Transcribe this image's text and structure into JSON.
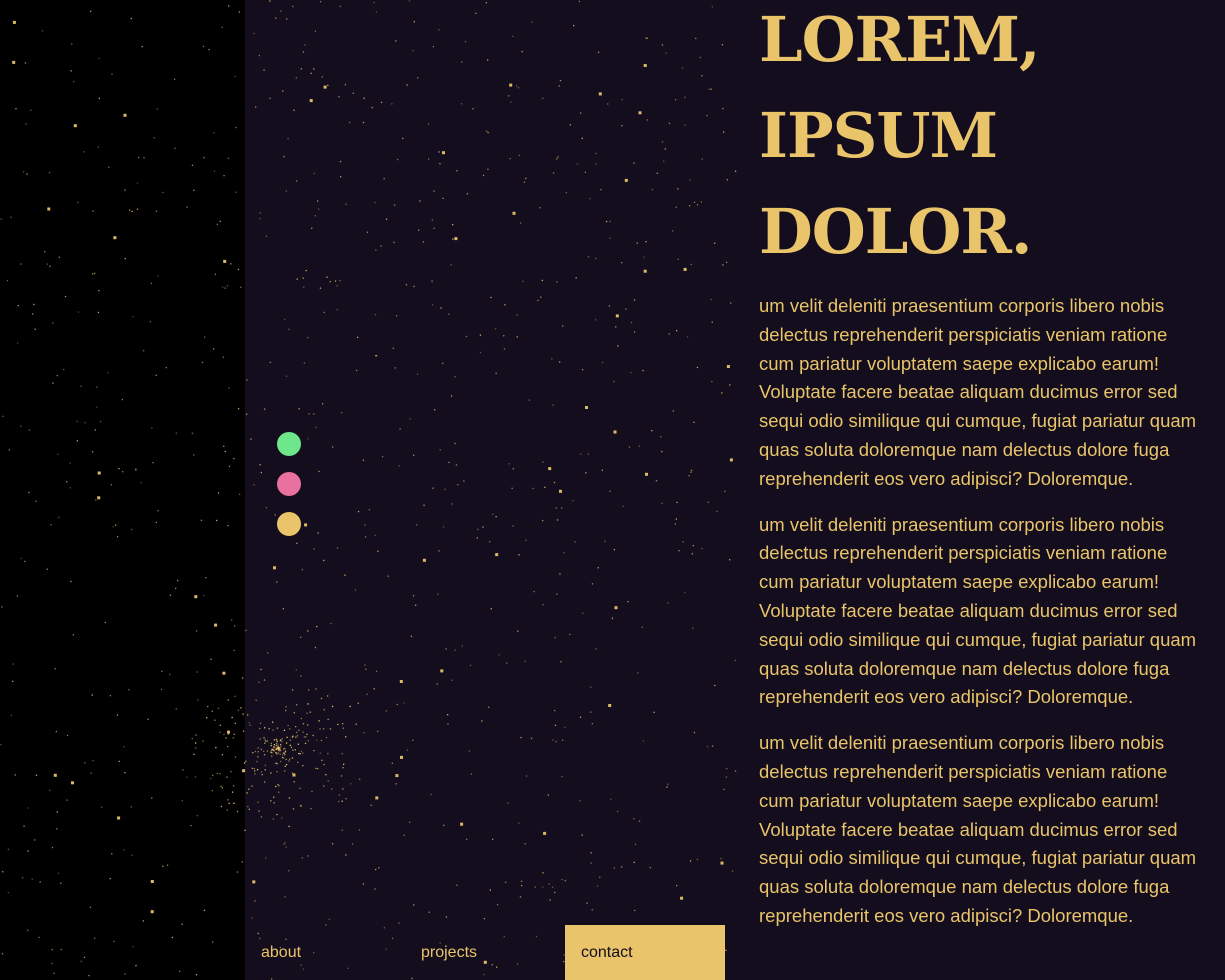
{
  "colors": {
    "background": "#000000",
    "panel": "#140d1d",
    "accent": "#e9c46a",
    "dot_green": "#6ee68c",
    "dot_pink": "#e8719f",
    "dot_yellow": "#e9c46a"
  },
  "headline": {
    "line1": "LOREM,",
    "line2": "IPSUM",
    "line3": "DOLOR."
  },
  "paragraphs": [
    "um velit deleniti praesentium corporis libero nobis delectus reprehenderit perspiciatis veniam ratione cum pariatur voluptatem saepe explicabo earum! Voluptate facere beatae aliquam ducimus error sed sequi odio similique qui cumque, fugiat pariatur quam quas soluta doloremque nam delectus dolore fuga reprehenderit eos vero adipisci? Doloremque.",
    "um velit deleniti praesentium corporis libero nobis delectus reprehenderit perspiciatis veniam ratione cum pariatur voluptatem saepe explicabo earum! Voluptate facere beatae aliquam ducimus error sed sequi odio similique qui cumque, fugiat pariatur quam quas soluta doloremque nam delectus dolore fuga reprehenderit eos vero adipisci? Doloremque.",
    "um velit deleniti praesentium corporis libero nobis delectus reprehenderit perspiciatis veniam ratione cum pariatur voluptatem saepe explicabo earum! Voluptate facere beatae aliquam ducimus error sed sequi odio similique qui cumque, fugiat pariatur quam quas soluta doloremque nam delectus dolore fuga reprehenderit eos vero adipisci? Doloremque."
  ],
  "theme_dots": [
    {
      "name": "theme-dot-green",
      "color": "#6ee68c"
    },
    {
      "name": "theme-dot-pink",
      "color": "#e8719f"
    },
    {
      "name": "theme-dot-yellow",
      "color": "#e9c46a"
    }
  ],
  "nav": {
    "about": "about",
    "projects": "projects",
    "contact": "contact",
    "active": "contact"
  }
}
